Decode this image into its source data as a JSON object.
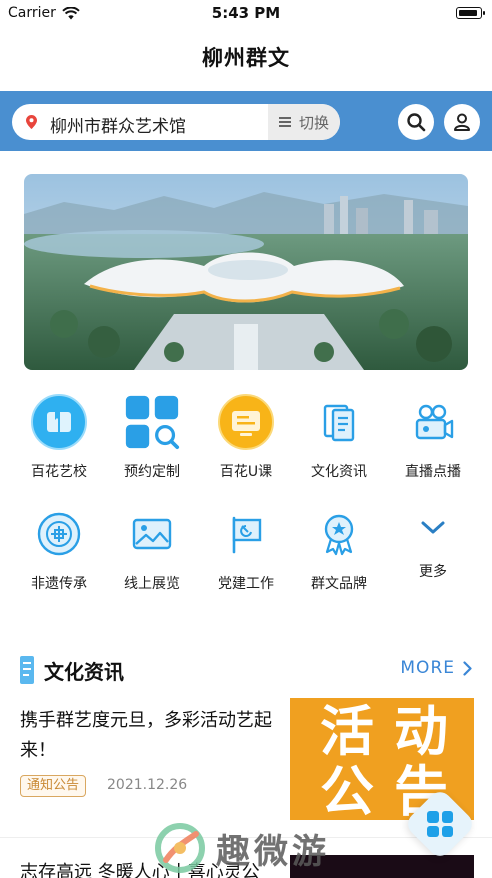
{
  "status_bar": {
    "carrier": "Carrier",
    "time": "5:43 PM",
    "battery_level": 0.9
  },
  "nav": {
    "title": "柳州群文"
  },
  "search_bar": {
    "location": "柳州市群众艺术馆",
    "switch_label": "切换",
    "search_icon": "search-icon",
    "user_icon": "user-icon"
  },
  "banner": {
    "image": "architecture-rendering"
  },
  "menu": {
    "items": [
      {
        "label": "百花艺校",
        "icon": "book-circle-icon"
      },
      {
        "label": "预约定制",
        "icon": "grid-search-icon"
      },
      {
        "label": "百花U课",
        "icon": "screen-circle-icon"
      },
      {
        "label": "文化资讯",
        "icon": "document-icon"
      },
      {
        "label": "直播点播",
        "icon": "camera-icon"
      },
      {
        "label": "非遗传承",
        "icon": "heritage-icon"
      },
      {
        "label": "线上展览",
        "icon": "picture-icon"
      },
      {
        "label": "党建工作",
        "icon": "flag-icon"
      },
      {
        "label": "群文品牌",
        "icon": "award-icon"
      },
      {
        "label": "更多",
        "icon": "chevron-down-icon"
      }
    ]
  },
  "news_section": {
    "title": "文化资讯",
    "more_label": "MORE",
    "items": [
      {
        "title": "携手群艺度元旦，多彩活动艺起来！",
        "tag": "通知公告",
        "date": "2021.12.26",
        "thumb_words": [
          "活",
          "动",
          "公",
          "告"
        ]
      },
      {
        "title": "志存高远 冬暖人心丨喜心灵公"
      }
    ]
  },
  "watermark": {
    "text": "趣微游"
  },
  "colors": {
    "accent": "#4a8fd0",
    "link": "#3a86d6",
    "tag": "#c98a35",
    "thumb": "#f0a020"
  }
}
